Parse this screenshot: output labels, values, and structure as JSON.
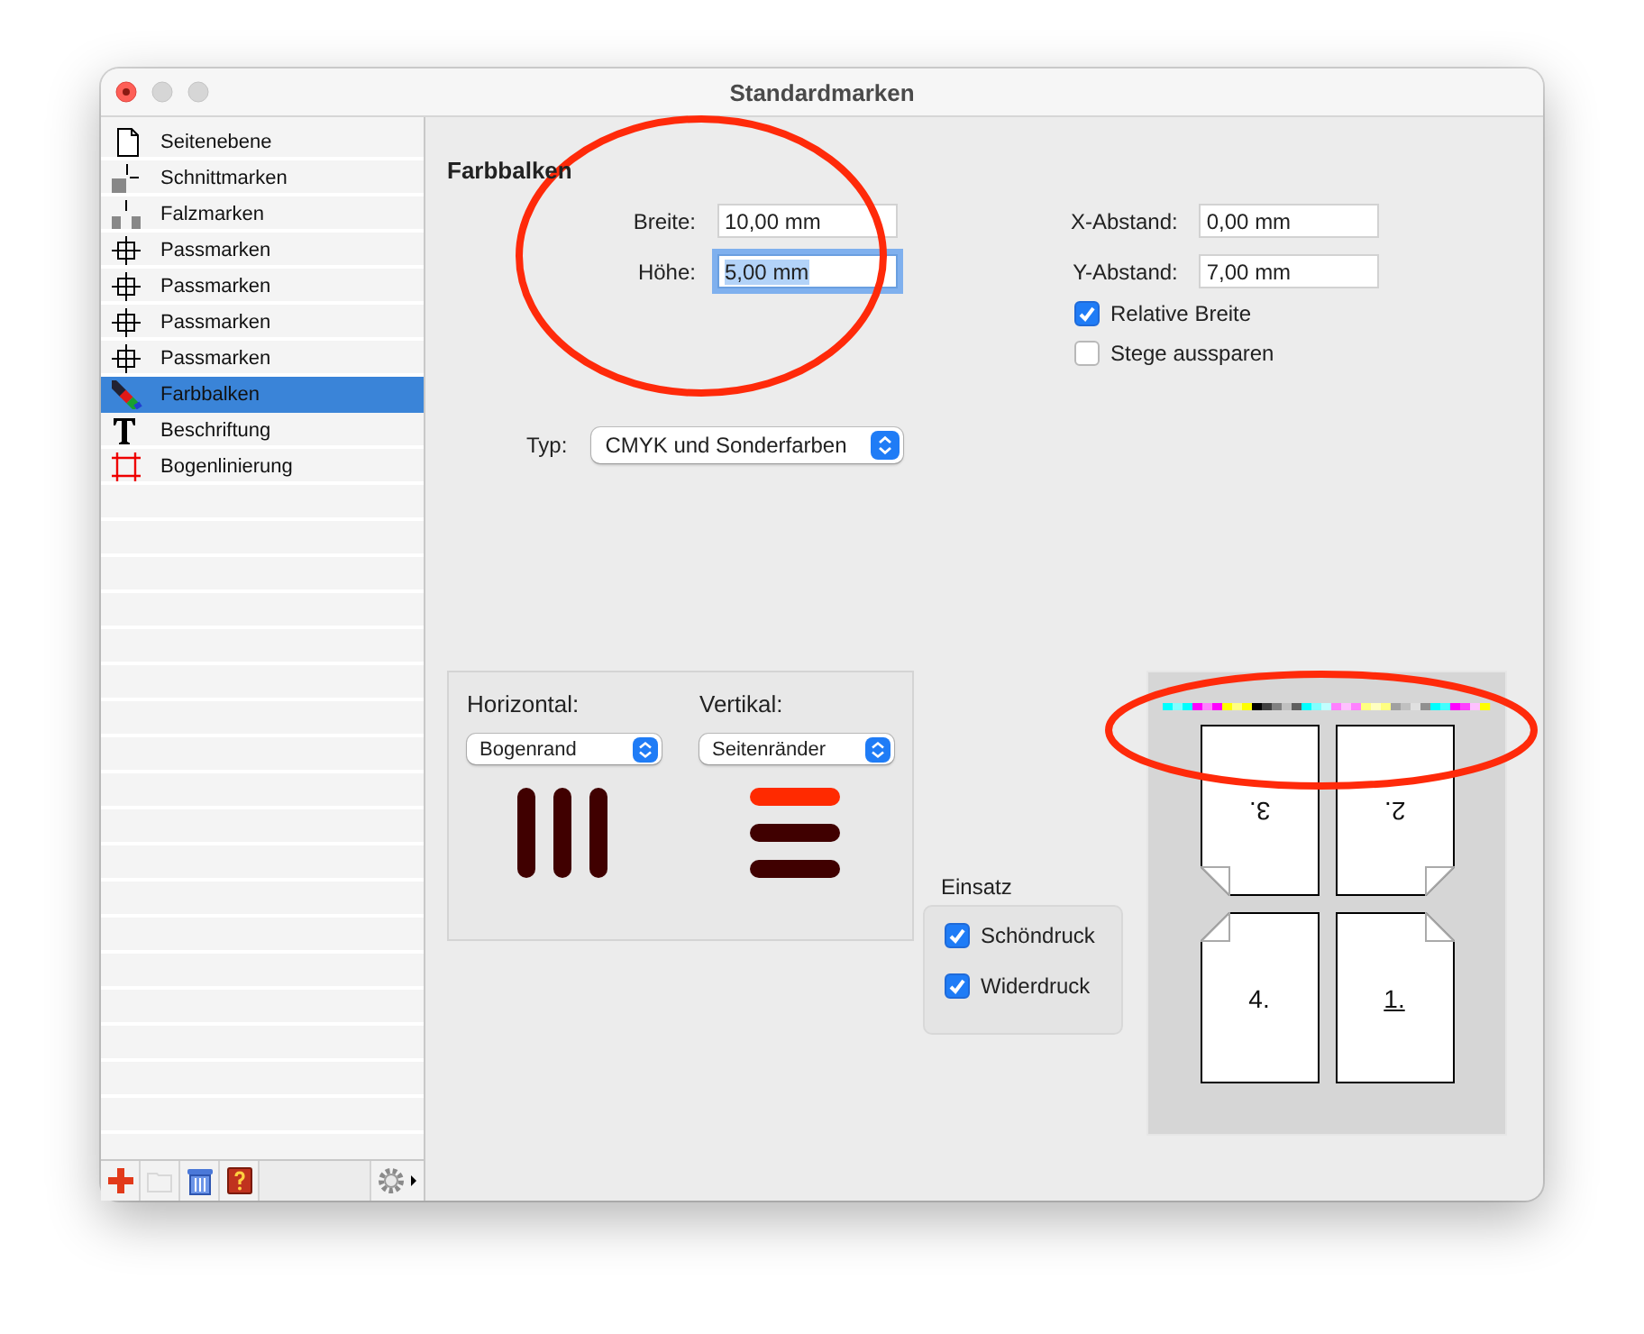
{
  "window": {
    "title": "Standardmarken"
  },
  "sidebar": {
    "items": [
      {
        "label": "Seitenebene",
        "kind": "page",
        "selected": false
      },
      {
        "label": "Schnittmarken",
        "kind": "cut",
        "selected": false
      },
      {
        "label": "Falzmarken",
        "kind": "fold",
        "selected": false
      },
      {
        "label": "Passmarken",
        "kind": "register",
        "selected": false
      },
      {
        "label": "Passmarken",
        "kind": "register",
        "selected": false
      },
      {
        "label": "Passmarken",
        "kind": "register",
        "selected": false
      },
      {
        "label": "Passmarken",
        "kind": "register",
        "selected": false
      },
      {
        "label": "Farbbalken",
        "kind": "colorbar",
        "selected": true
      },
      {
        "label": "Beschriftung",
        "kind": "text",
        "selected": false
      },
      {
        "label": "Bogenlinierung",
        "kind": "lines",
        "selected": false
      }
    ]
  },
  "panel": {
    "title": "Farbbalken",
    "left_fields": [
      {
        "label": "Breite:",
        "value": "10,00 mm",
        "focused": false
      },
      {
        "label": "Höhe:",
        "value": "5,00 mm",
        "focused": true
      }
    ],
    "right_fields": [
      {
        "label": "X-Abstand:",
        "value": "0,00 mm",
        "focused": false
      },
      {
        "label": "Y-Abstand:",
        "value": "7,00 mm",
        "focused": false
      }
    ],
    "options": [
      {
        "label": "Relative Breite",
        "checked": true
      },
      {
        "label": "Stege aussparen",
        "checked": false
      }
    ],
    "type": {
      "label": "Typ:",
      "value": "CMYK und Sonderfarben"
    },
    "orientation": [
      {
        "label": "Horizontal:",
        "value": "Bogenrand",
        "kind": "vertical-bars"
      },
      {
        "label": "Vertikal:",
        "value": "Seitenränder",
        "kind": "horizontal-bars"
      }
    ],
    "insert": {
      "label": "Einsatz",
      "options": [
        {
          "label": "Schöndruck",
          "checked": true
        },
        {
          "label": "Widerdruck",
          "checked": true
        }
      ]
    },
    "preview": {
      "pages": [
        {
          "label": "3.",
          "upside_down": true,
          "kind": "fold-bottom-left",
          "underlined": false
        },
        {
          "label": "2.",
          "upside_down": true,
          "kind": "fold-bottom-right",
          "underlined": false
        },
        {
          "label": "4.",
          "upside_down": false,
          "kind": "fold-top-left",
          "underlined": false
        },
        {
          "label": "1.",
          "upside_down": false,
          "kind": "fold-top-right",
          "underlined": true
        }
      ]
    }
  }
}
